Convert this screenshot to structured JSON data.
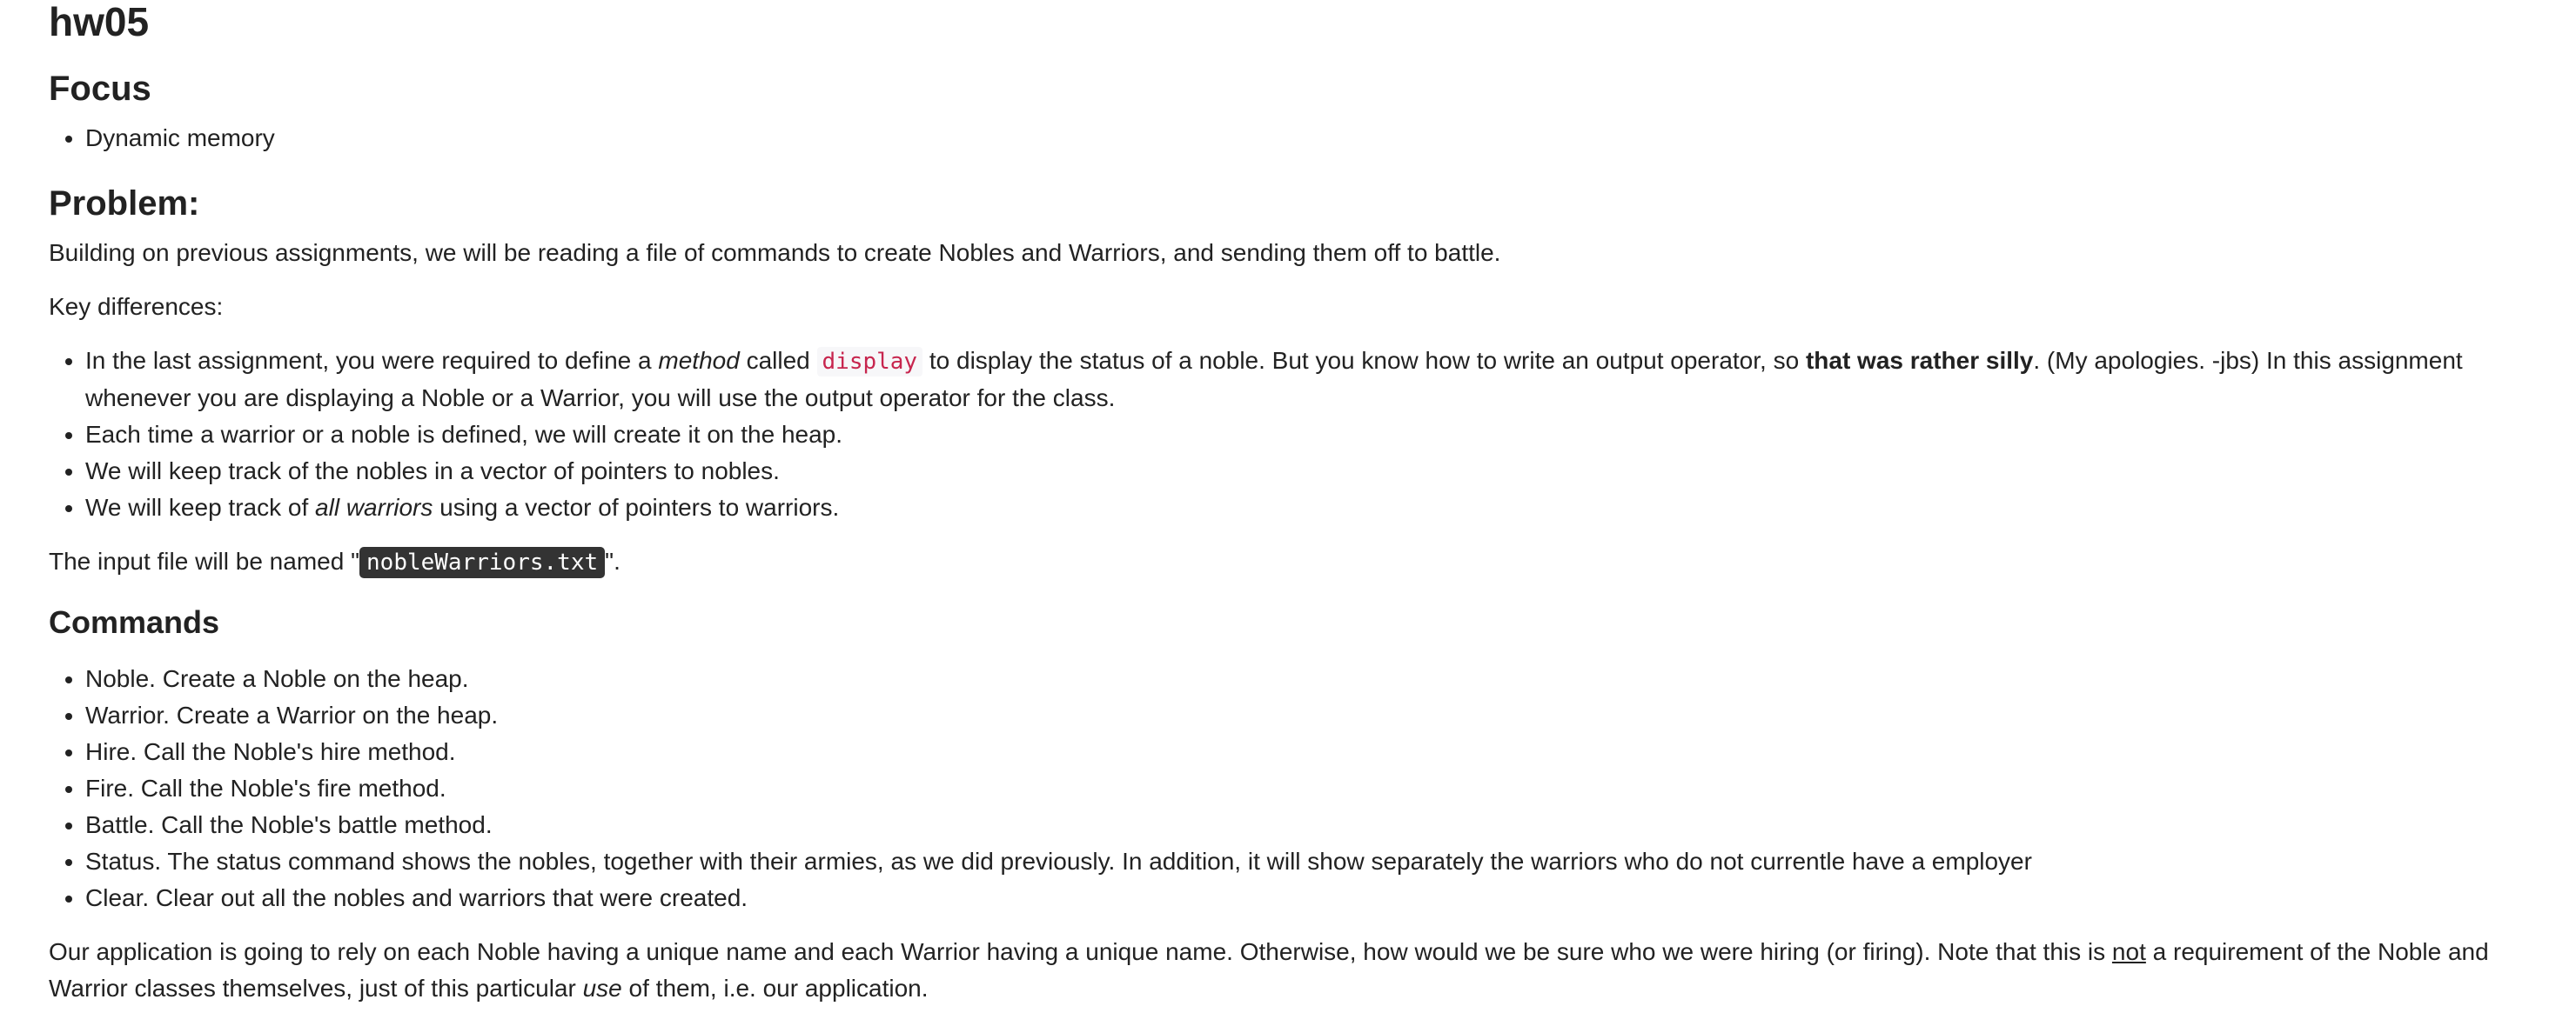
{
  "title": "hw05",
  "focus": {
    "heading": "Focus",
    "items": [
      "Dynamic memory"
    ]
  },
  "problem": {
    "heading": "Problem:",
    "intro": "Building on previous assignments, we will be reading a file of commands to create Nobles and Warriors, and sending them off to battle.",
    "key_differences_label": "Key differences:",
    "differences": {
      "item1": {
        "pre": "In the last assignment, you were required to define a ",
        "em": "method",
        "mid1": " called ",
        "code": "display",
        "mid2": " to display the status of a noble. But you know how to write an output operator, so ",
        "strong": "that was rather silly",
        "post": ". (My apologies. -jbs) In this assignment whenever you are displaying a Noble or a Warrior, you will use the output operator for the class."
      },
      "item2": "Each time a warrior or a noble is defined, we will create it on the heap.",
      "item3": "We will keep track of the nobles in a vector of pointers to nobles.",
      "item4": {
        "pre": "We will keep track of ",
        "em": "all warriors",
        "post": " using a vector of pointers to warriors."
      }
    },
    "input_file": {
      "pre": "The input file will be named \"",
      "filename": "nobleWarriors.txt",
      "post": "\"."
    }
  },
  "commands": {
    "heading": "Commands",
    "items": [
      "Noble. Create a Noble on the heap.",
      "Warrior. Create a Warrior on the heap.",
      "Hire. Call the Noble's hire method.",
      "Fire. Call the Noble's fire method.",
      "Battle. Call the Noble's battle method.",
      "Status. The status command shows the nobles, together with their armies, as we did previously. In addition, it will show separately the warriors who do not currentle have a employer",
      "Clear. Clear out all the nobles and warriors that were created."
    ]
  },
  "application_note": {
    "pre": "Our application is going to rely on each Noble having a unique name and each Warrior having a unique name. Otherwise, how would we be sure who we were hiring (or firing). Note that this is ",
    "underlined": "not",
    "mid": " a requirement of the Noble and Warrior classes themselves, just of this particular ",
    "em": "use",
    "post": " of them, i.e. our application."
  }
}
